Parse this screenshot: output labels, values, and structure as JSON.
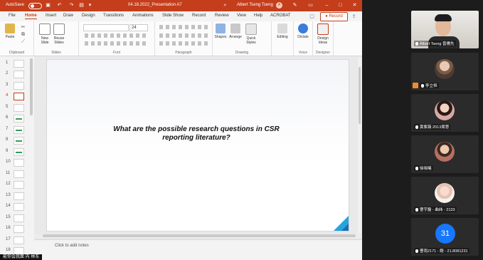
{
  "titlebar": {
    "autosave": "AutoSave",
    "doc_title": "04.18.2022_Presentation A7",
    "user": "Albert Tseng Tseng",
    "user_initial": "A"
  },
  "tabs": [
    "File",
    "Home",
    "Insert",
    "Draw",
    "Design",
    "Transitions",
    "Animations",
    "Slide Show",
    "Record",
    "Review",
    "View",
    "Help",
    "ACROBAT"
  ],
  "active_tab": "Home",
  "record_label": "Record",
  "ribbon": {
    "clipboard": {
      "paste": "Paste",
      "label": "Clipboard"
    },
    "slides": {
      "new_slide": "New Slide",
      "reuse": "Reuse Slides",
      "label": "Slides"
    },
    "font": {
      "label": "Font",
      "size": "24"
    },
    "paragraph": {
      "label": "Paragraph"
    },
    "drawing": {
      "shapes": "Shapes",
      "arrange": "Arrange",
      "quick": "Quick Styles",
      "label": "Drawing"
    },
    "editing": {
      "editing": "Editing"
    },
    "voice": {
      "dictate": "Dictate",
      "label": "Voice"
    },
    "designer": {
      "design_ideas": "Design Ideas",
      "label": "Designer"
    }
  },
  "thumbnails": [
    "1",
    "2",
    "3",
    "4",
    "5",
    "6",
    "7",
    "8",
    "9",
    "10",
    "11",
    "12",
    "13",
    "14",
    "15",
    "16",
    "17",
    "18"
  ],
  "selected_slide": "4",
  "slide": {
    "title_line1": "What are the possible research questions in CSR",
    "title_line2": "reporting literature?"
  },
  "notes_placeholder": "Click to add notes",
  "subtitle": "能你会我面 内 林东",
  "participants": [
    {
      "name": "Albert Tseng 曾儒先"
    },
    {
      "name": "李立恒"
    },
    {
      "name": "黄紫薇 2013周慧"
    },
    {
      "name": "徐晓曦"
    },
    {
      "name": "曹宇磊 - 曲纬 - 2133"
    },
    {
      "name": "曹雨2171 - 鲍 - 21.8081231",
      "avatar_number": "31"
    }
  ],
  "colors": {
    "accent": "#c43e1c",
    "slide_corner": "#27a3dd",
    "zoom_blue": "#1677ff"
  }
}
